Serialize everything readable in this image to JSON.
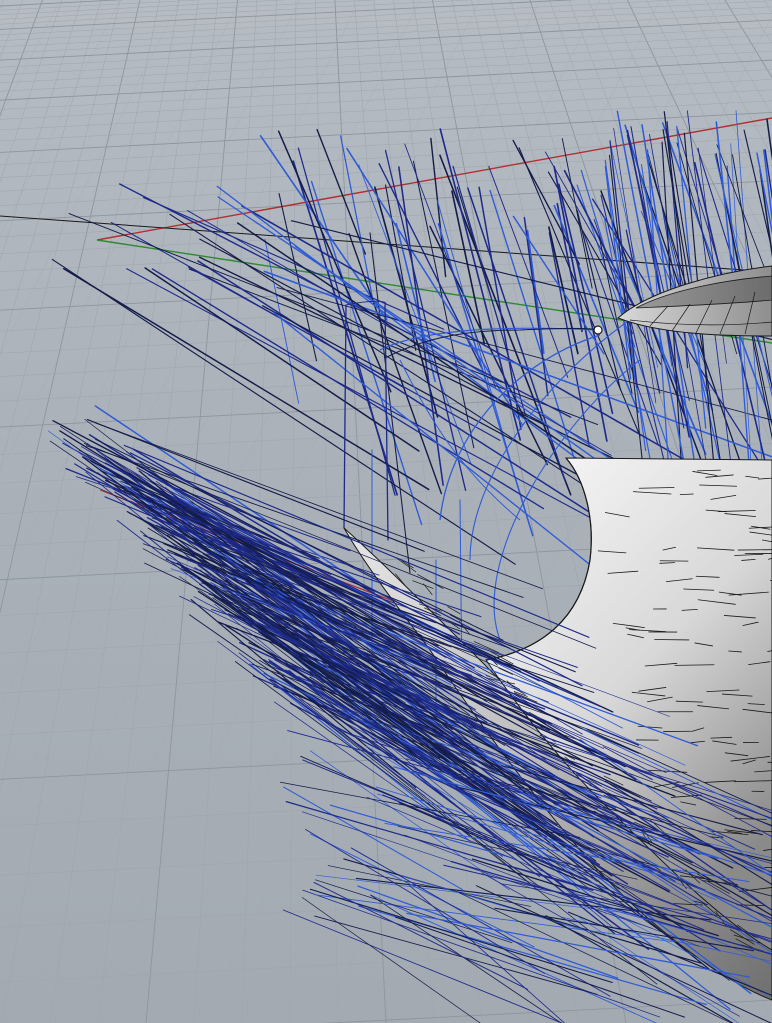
{
  "viewport": {
    "view": "perspective",
    "colors": {
      "background": "#aab1b9",
      "grid_minor": "#9da5ae",
      "grid_major": "#8d959e",
      "x_axis": "#b03030",
      "y_axis": "#2f8a2f",
      "curve_dark": "#141c48",
      "curve_navy": "#1e2a8a",
      "curve_blue": "#2f5bd6",
      "surface_light": "#f2f2f2",
      "surface_mid": "#c9c9c9",
      "surface_dark": "#7d7d7d",
      "edge": "#1a1a1a"
    },
    "objects": {
      "grid": "construction-plane-grid",
      "x_axis": "red-axis-line",
      "y_axis": "green-axis-line",
      "surfaces": [
        "bowl-surface",
        "ring-surface"
      ],
      "curves": "curve-fan",
      "point": "control-point"
    }
  }
}
